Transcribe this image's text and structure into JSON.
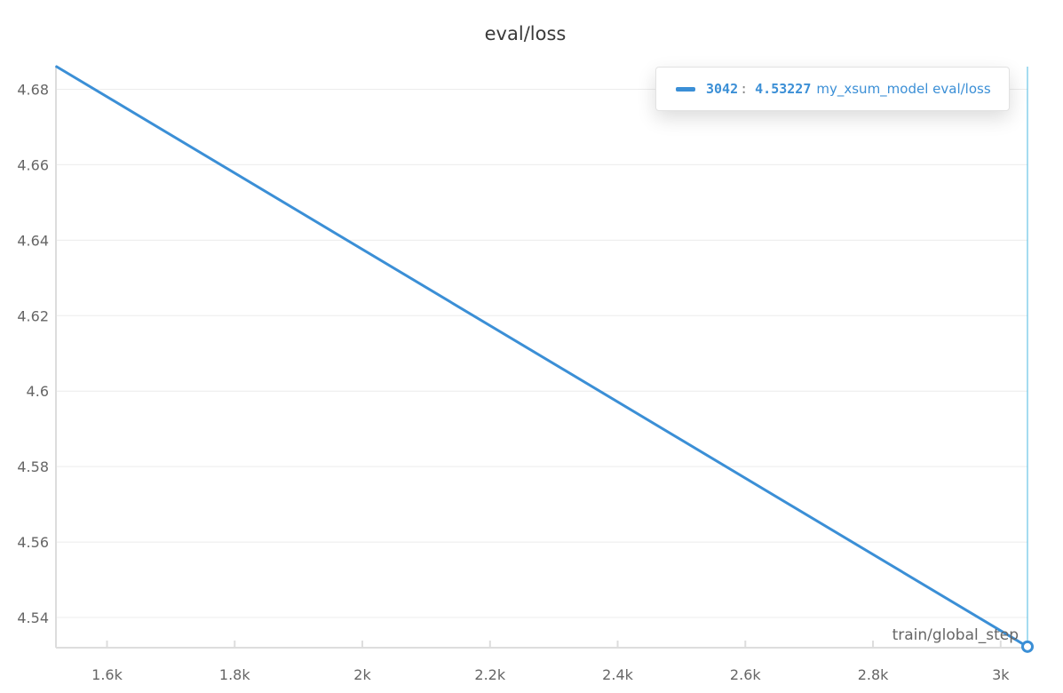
{
  "chart_data": {
    "type": "line",
    "title": "eval/loss",
    "xlabel": "train/global_step",
    "ylabel": "",
    "xlim": [
      1520,
      3042
    ],
    "ylim": [
      4.532,
      4.686
    ],
    "xticks": [
      1600,
      1800,
      2000,
      2200,
      2400,
      2600,
      2800,
      3000
    ],
    "xtick_labels": [
      "1.6k",
      "1.8k",
      "2k",
      "2.2k",
      "2.4k",
      "2.6k",
      "2.8k",
      "3k"
    ],
    "yticks": [
      4.54,
      4.56,
      4.58,
      4.6,
      4.62,
      4.64,
      4.66,
      4.68
    ],
    "ytick_labels": [
      "4.54",
      "4.56",
      "4.58",
      "4.6",
      "4.62",
      "4.64",
      "4.66",
      "4.68"
    ],
    "grid": true,
    "series": [
      {
        "name": "my_xsum_model eval/loss",
        "color": "#3b8fd6",
        "x": [
          1521,
          3042
        ],
        "y": [
          4.686,
          4.53227
        ]
      }
    ],
    "hover": {
      "step": "3042",
      "value": "4.53227",
      "run": "my_xsum_model eval/loss",
      "x": 3042,
      "y": 4.53227
    }
  },
  "colors": {
    "line": "#3b8fd6",
    "hover_line": "#4bb8e0",
    "grid": "#ececec",
    "axis": "#dddddd"
  }
}
